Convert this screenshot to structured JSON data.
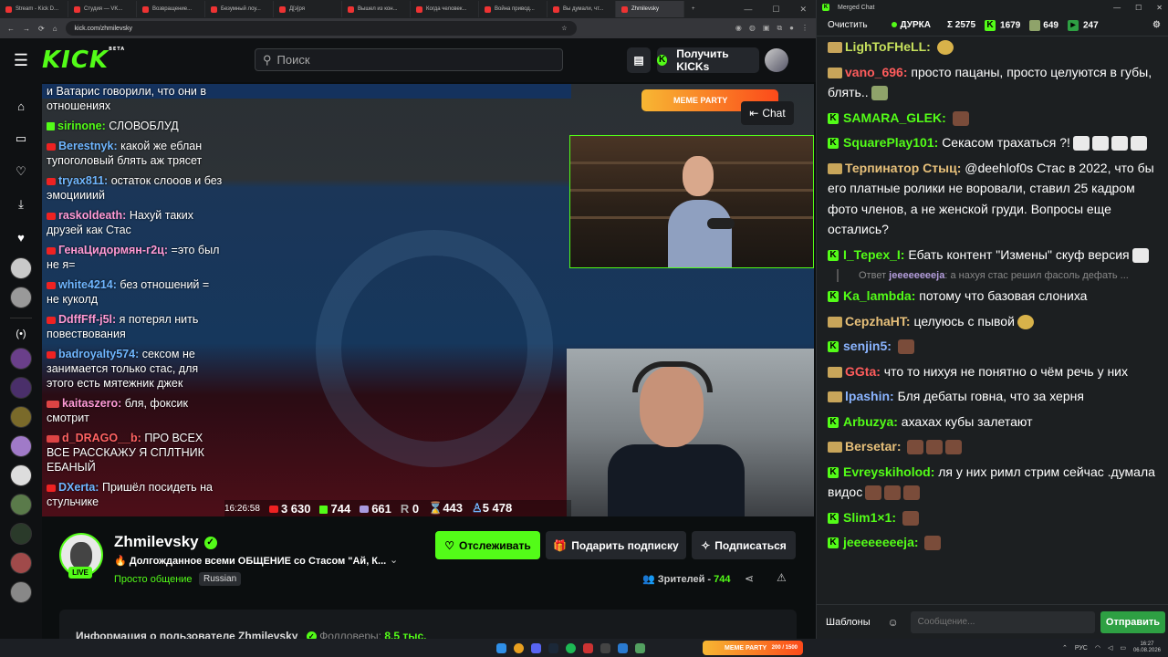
{
  "browser": {
    "tabs": [
      {
        "label": "Stream - Kick D..."
      },
      {
        "label": "Студия — VK..."
      },
      {
        "label": "Возвращение..."
      },
      {
        "label": "Безумный лоу..."
      },
      {
        "label": "Д[э]ря"
      },
      {
        "label": "Вышел из кон..."
      },
      {
        "label": "Когда человек..."
      },
      {
        "label": "Война привод..."
      },
      {
        "label": "Вы думали, чт..."
      },
      {
        "label": "Zhmilevsky"
      }
    ],
    "new_tab": "+",
    "url": "kick.com/zhmilevsky"
  },
  "header": {
    "logo": "KICK",
    "logo_beta": "BETA",
    "search_placeholder": "Поиск",
    "kicks_button": "Получить KICKs"
  },
  "stream_chat": [
    {
      "platform": "none",
      "user": "",
      "text": "и Ватарис говорили, что они в отношениях",
      "color": "#ffffff"
    },
    {
      "platform": "kick",
      "user": "sirinone:",
      "text": "СЛОВОБЛУД",
      "color": "#53fc18"
    },
    {
      "platform": "yt",
      "user": "Berestnyk:",
      "text": "какой же еблан тупоголовый блять аж трясет",
      "color": "#6fb6ff"
    },
    {
      "platform": "yt",
      "user": "tryax811:",
      "text": "остаток слооов и без эмоциииий",
      "color": "#6fb6ff"
    },
    {
      "platform": "yt",
      "user": "raskoldeath:",
      "text": "Нахуй таких друзей как Стас",
      "color": "#ff9ad6"
    },
    {
      "platform": "yt",
      "user": "ГенаЦидормян-г2ц:",
      "text": "=это был не я=",
      "color": "#ff9ad6"
    },
    {
      "platform": "yt",
      "user": "white4214:",
      "text": "без отношений = не куколд",
      "color": "#6fb6ff"
    },
    {
      "platform": "yt",
      "user": "DdffFff-j5l:",
      "text": "я потерял нить повествования",
      "color": "#ff9ad6"
    },
    {
      "platform": "yt",
      "user": "badroyalty574:",
      "text": "сексом не занимается только стас, для этого есть мятежник джек",
      "color": "#6fb6ff"
    },
    {
      "platform": "live",
      "user": "kaitaszero:",
      "text": "бля, фоксик смотрит",
      "color": "#ff9ad6"
    },
    {
      "platform": "live",
      "user": "d_DRAGO__b:",
      "text": "ПРО ВСЕХ ВСЕ РАССКАЖУ Я СПЛТНИК ЕБАНЫЙ",
      "color": "#ff6262"
    },
    {
      "platform": "yt",
      "user": "DXerta:",
      "text": "Пришёл посидеть на стульчике",
      "color": "#6fb6ff"
    }
  ],
  "overlay": {
    "meme_party": "MEME PARTY",
    "chat_button": "Chat",
    "time": "16:26:58",
    "yt_viewers": "3 630",
    "kick_viewers": "744",
    "live_viewers": "661",
    "r_viewers": "0",
    "x_viewers": "443",
    "total_viewers": "5 478"
  },
  "channel": {
    "name": "Zhmilevsky",
    "live_badge": "LIVE",
    "title": "Долгожданное всеми ОБЩЕНИЕ со Стасом \"Ай, К...",
    "category": "Просто общение",
    "language": "Russian",
    "follow": "Отслеживать",
    "gift": "Подарить подписку",
    "subscribe": "Подписаться",
    "viewers_label": "Зрителей - ",
    "viewers": "744",
    "about": "Информация о пользователе Zhmilevsky",
    "followers_label": "Фолловеры:",
    "followers": "8.5 тыс."
  },
  "merged_chat": {
    "window_title": "Merged Chat",
    "clear": "Очистить",
    "channel": "ДУРКА",
    "sum": "Σ 2575",
    "kick": "1679",
    "tw": "649",
    "other": "247",
    "templates": "Шаблоны",
    "input_placeholder": "Сообщение...",
    "send": "Отправить",
    "messages": [
      {
        "p": "tw",
        "user": "LighToFHeLL:",
        "text": "",
        "color": "#c6e05c",
        "emotes": [
          "round"
        ]
      },
      {
        "p": "tw",
        "user": "vano_696:",
        "text": "просто пацаны, просто целуются в губы, блять..",
        "color": "#ff5c5c",
        "emotes": [
          "g"
        ]
      },
      {
        "p": "kick",
        "user": "SAMARA_GLEK:",
        "text": "",
        "color": "#53fc18",
        "emotes": [
          "b"
        ]
      },
      {
        "p": "kick",
        "user": "SquarePlay101:",
        "text": "Секасом трахаться ?!",
        "color": "#53fc18",
        "emotes": [
          "w",
          "w",
          "w",
          "w"
        ]
      },
      {
        "p": "tw",
        "user": "Терпинатор Стыц:",
        "text": "@deehlof0s Стас в 2022, что бы его платные ролики не воровали, ставил 25 кадром фото членов, а не женской груди. Вопросы еще остались?",
        "color": "#e7c07a",
        "emotes": []
      },
      {
        "p": "kick",
        "user": "I_Tepex_I:",
        "text": "Ебать контент \"Измены\" скуф версия",
        "color": "#53fc18",
        "emotes": [
          "w"
        ]
      },
      {
        "p": "reply",
        "user": "jeeeeeeeeja",
        "text": "а нахуя стас решил фасоль дефать ...",
        "label": "Ответ"
      },
      {
        "p": "kick",
        "user": "Ka_lambda:",
        "text": "потому что базовая слониха",
        "color": "#53fc18",
        "emotes": []
      },
      {
        "p": "tw",
        "user": "CepzhaHT:",
        "text": "целуюсь с пывой",
        "color": "#e7c07a",
        "emotes": [
          "round"
        ]
      },
      {
        "p": "kick",
        "user": "senjin5:",
        "text": "",
        "color": "#8ab4ff",
        "emotes": [
          "b"
        ]
      },
      {
        "p": "tw",
        "user": "GGta:",
        "text": "что то нихуя не понятно о чём речь у них",
        "color": "#ff5c5c",
        "emotes": []
      },
      {
        "p": "tw",
        "user": "lpashin:",
        "text": "Бля дебаты говна, что за херня",
        "color": "#8ab4ff",
        "emotes": []
      },
      {
        "p": "kick",
        "user": "Arbuzya:",
        "text": "ахахах кубы залетают",
        "color": "#53fc18",
        "emotes": []
      },
      {
        "p": "tw",
        "user": "Bersetar:",
        "text": "",
        "color": "#e7c07a",
        "emotes": [
          "b",
          "b",
          "b"
        ]
      },
      {
        "p": "kick",
        "user": "Evreyskiholod:",
        "text": "ля у них римл стрим сейчас .думала видос",
        "color": "#53fc18",
        "emotes": [
          "b",
          "b",
          "b"
        ]
      },
      {
        "p": "kick",
        "user": "Slim1×1:",
        "text": "",
        "color": "#53fc18",
        "emotes": [
          "b"
        ]
      },
      {
        "p": "kick",
        "user": "jeeeeeeeeja:",
        "text": "",
        "color": "#53fc18",
        "emotes": [
          "b"
        ]
      }
    ]
  },
  "taskbar": {
    "meme_party": "MEME PARTY",
    "progress": "200 / 1500",
    "lang": "РУС",
    "time": "16:27",
    "date": "06.08.2026"
  }
}
